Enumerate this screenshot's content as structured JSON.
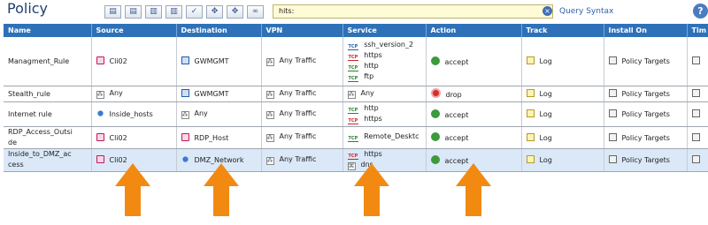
{
  "window": {
    "title": "Policy"
  },
  "toolbar": {
    "search_value": "hits:",
    "query_syntax_label": "Query Syntax",
    "help_label": "?"
  },
  "columns": [
    "Name",
    "Source",
    "Destination",
    "VPN",
    "Service",
    "Action",
    "Track",
    "Install On",
    "Tim"
  ],
  "rows": [
    {
      "name": "Managment_Rule",
      "source": "Cli02",
      "source_icon": "host-icon",
      "destination": "GWMGMT",
      "destination_icon": "gateway-icon",
      "vpn": "Any Traffic",
      "services": [
        "ssh_version_2",
        "https",
        "http",
        "ftp"
      ],
      "action": "accept",
      "action_icon": "accept-icon",
      "track": "Log",
      "install_on": "Policy Targets"
    },
    {
      "name": "Stealth_rule",
      "source": "Any",
      "source_icon": "any-icon",
      "destination": "GWMGMT",
      "destination_icon": "gateway-icon",
      "vpn": "Any Traffic",
      "services": [
        "Any"
      ],
      "action": "drop",
      "action_icon": "drop-icon",
      "track": "Log",
      "install_on": "Policy Targets"
    },
    {
      "name": "Internet rule",
      "source": "Inside_hosts",
      "source_icon": "network-icon",
      "destination": "Any",
      "destination_icon": "any-icon",
      "vpn": "Any Traffic",
      "services": [
        "http",
        "https"
      ],
      "action": "accept",
      "action_icon": "accept-icon",
      "track": "Log",
      "install_on": "Policy Targets"
    },
    {
      "name": "RDP_Access_Outside",
      "source": "Cli02",
      "source_icon": "host-icon",
      "destination": "RDP_Host",
      "destination_icon": "host-icon",
      "vpn": "Any Traffic",
      "services": [
        "Remote_Desktc"
      ],
      "action": "accept",
      "action_icon": "accept-icon",
      "track": "Log",
      "install_on": "Policy Targets"
    },
    {
      "name": "Inside_to_DMZ_access",
      "source": "Cli02",
      "source_icon": "host-icon",
      "destination": "DMZ_Network",
      "destination_icon": "network-icon",
      "vpn": "Any Traffic",
      "services": [
        "https",
        "dns"
      ],
      "action": "accept",
      "action_icon": "accept-icon",
      "track": "Log",
      "install_on": "Policy Targets",
      "selected": true
    }
  ],
  "row_name_lines": {
    "r4": [
      "RDP_Access_Outsi",
      "de"
    ],
    "r5": [
      "Inside_to_DMZ_ac",
      "cess"
    ]
  },
  "service_tags": {
    "r1": [
      "TCP",
      "TCP",
      "TCP",
      "TCP"
    ],
    "r3": [
      "TCP",
      "TCP"
    ],
    "r4": [
      "TCP"
    ],
    "r5": [
      "TCP"
    ]
  },
  "colors": {
    "header_bg": "#2e71b8",
    "selected_row": "#dbe8f8",
    "arrow": "#f28a12",
    "accept": "#3c9a3c",
    "drop": "#d32f2f"
  }
}
